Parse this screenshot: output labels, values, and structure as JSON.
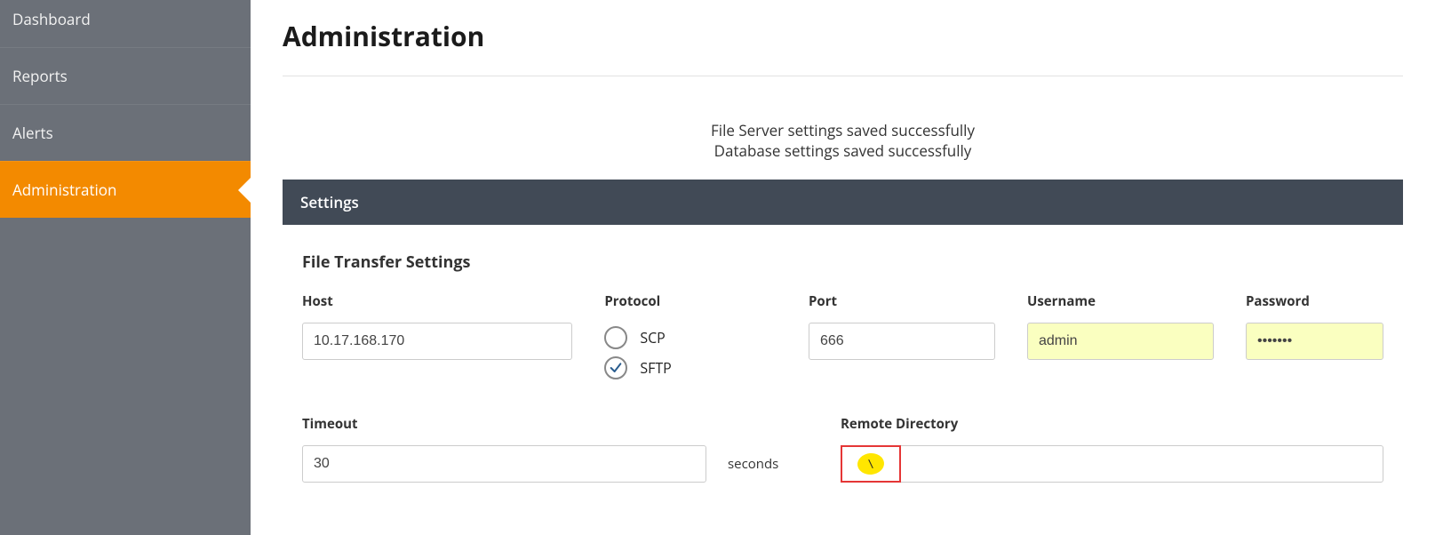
{
  "sidebar": {
    "items": [
      {
        "label": "Dashboard",
        "active": false
      },
      {
        "label": "Reports",
        "active": false
      },
      {
        "label": "Alerts",
        "active": false
      },
      {
        "label": "Administration",
        "active": true
      }
    ]
  },
  "page": {
    "title": "Administration"
  },
  "status": {
    "line1": "File Server settings saved successfully",
    "line2": "Database settings saved successfully"
  },
  "panel": {
    "title": "Settings",
    "section_title": "File Transfer Settings"
  },
  "form": {
    "host_label": "Host",
    "host_value": "10.17.168.170",
    "protocol_label": "Protocol",
    "protocol_options": {
      "scp": "SCP",
      "sftp": "SFTP"
    },
    "protocol_selected": "sftp",
    "port_label": "Port",
    "port_value": "666",
    "username_label": "Username",
    "username_value": "admin",
    "password_label": "Password",
    "password_value": "•••••••",
    "timeout_label": "Timeout",
    "timeout_value": "30",
    "timeout_suffix": "seconds",
    "remote_dir_label": "Remote Directory",
    "remote_dir_addon": "\\",
    "remote_dir_value": ""
  }
}
